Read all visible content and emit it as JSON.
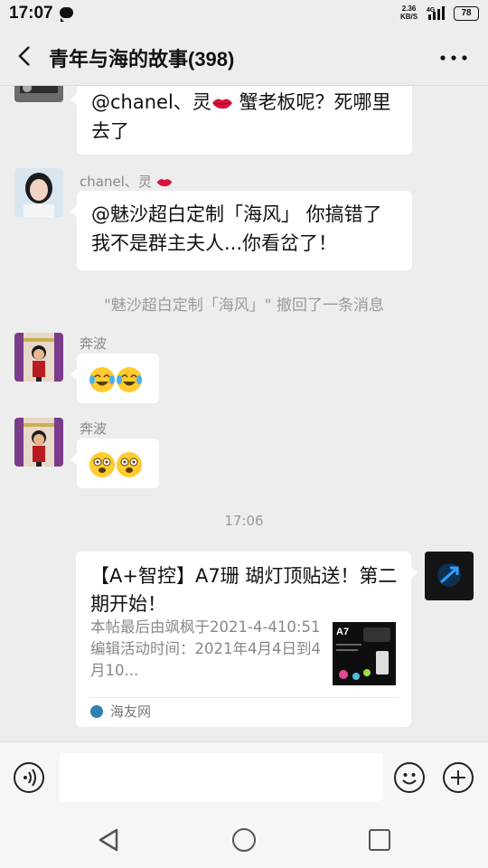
{
  "status_bar": {
    "time": "17:07",
    "net_speed_value": "2.36",
    "net_speed_unit": "KB/S",
    "network": "4G",
    "battery": "78"
  },
  "header": {
    "title": "青年与海的故事(398)"
  },
  "messages": [
    {
      "text_before_emoji": "@chanel、灵",
      "text_after_emoji": " 蟹老板呢？死哪里去了"
    },
    {
      "sender": "chanel、灵",
      "text": "@魅沙超白定制「海风」 你搞错了我不是群主夫人...你看岔了！"
    },
    {
      "system": "\"魅沙超白定制「海风」\" 撤回了一条消息"
    },
    {
      "sender": "奔波"
    },
    {
      "sender": "奔波"
    }
  ],
  "timestamp": "17:06",
  "link_card": {
    "title": "【A+智控】A7珊 瑚灯顶贴送！第二期开始！",
    "description": "本帖最后由飒枫于2021-4-410:51编辑活动时间：2021年4月4日到4月10...",
    "thumbnail_text": "A7",
    "source": "海友网"
  },
  "colors": {
    "background": "#ededed",
    "bubble": "#ffffff",
    "emoji_yellow": "#ffcb2f",
    "lips_red": "#d8123c"
  },
  "icons": [
    "back-icon",
    "more-icon",
    "voice-icon",
    "emoji-icon",
    "plus-icon",
    "nav-back-icon",
    "nav-home-icon",
    "nav-recent-icon"
  ]
}
